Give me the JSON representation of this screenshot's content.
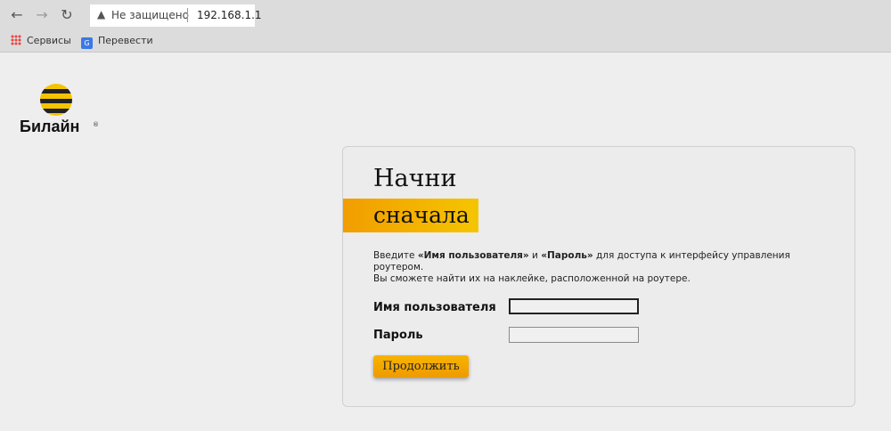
{
  "browser": {
    "security_label": "Не защищено",
    "url": "192.168.1.1",
    "bookmarks": [
      {
        "label": "Сервисы",
        "icon": "apps-grid-icon"
      },
      {
        "label": "Перевести",
        "icon": "translate-icon"
      }
    ]
  },
  "brand": {
    "name": "Билайн",
    "reg_mark": "®",
    "colors": {
      "yellow": "#f5c400",
      "orange": "#f29d00",
      "black": "#222222"
    }
  },
  "login": {
    "title_line1": "Начни",
    "title_line2": "сначала",
    "desc_prefix": "Введите ",
    "desc_user": "«Имя пользователя»",
    "desc_and": " и ",
    "desc_pass": "«Пароль»",
    "desc_suffix": " для доступа к интерфейсу управления роутером.",
    "desc_line2": "Вы сможете найти их на наклейке, расположенной на роутере.",
    "username_label": "Имя пользователя",
    "username_value": "",
    "password_label": "Пароль",
    "password_value": "",
    "submit_label": "Продолжить"
  }
}
